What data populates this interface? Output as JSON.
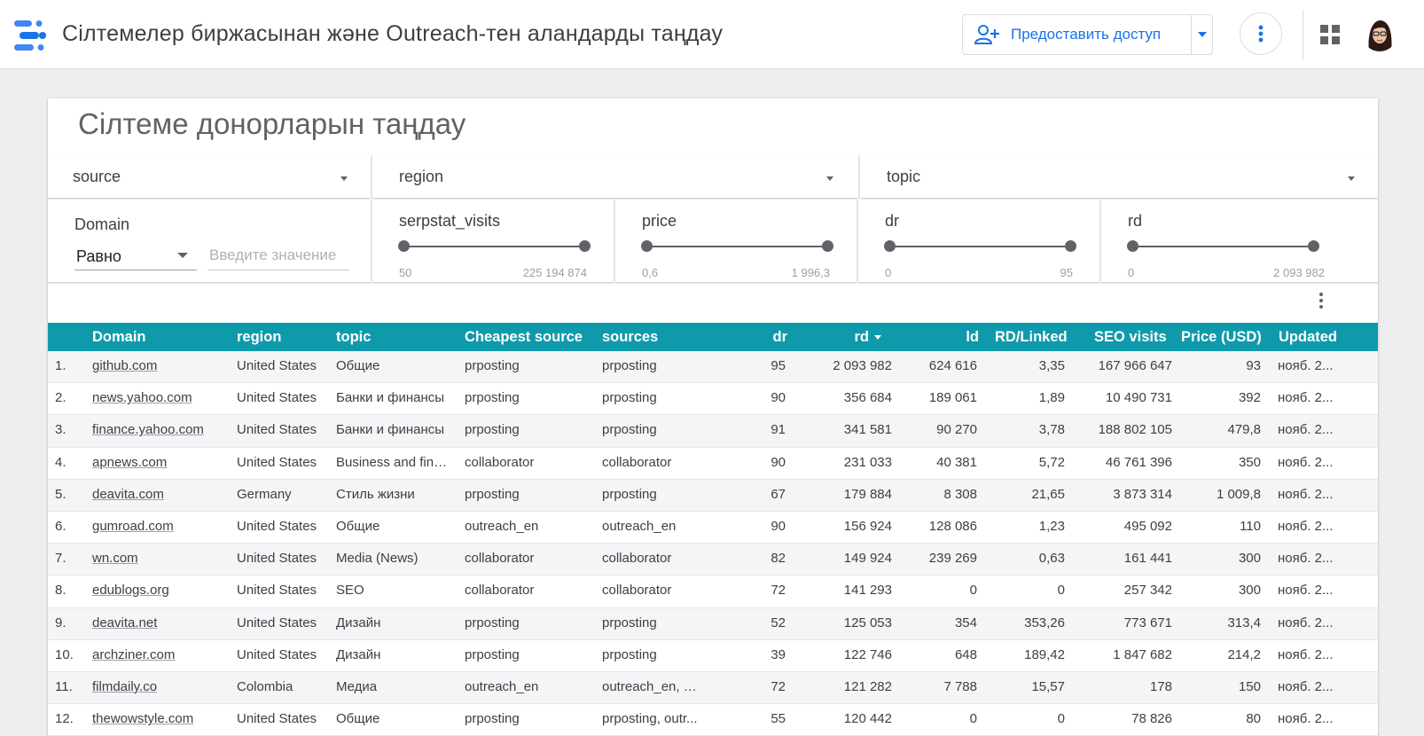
{
  "app": {
    "title": "Сілтемелер биржасынан және Outreach-тен аландарды таңдау",
    "share_label": "Предоставить доступ",
    "brand_colors": {
      "logo_blue": "#4285f4",
      "logo_dark": "#1a73e8",
      "accent": "#1a73e8",
      "table_header": "#0f9aab"
    },
    "icons": {
      "share": "person-add-icon",
      "more": "more-vert-icon",
      "apps": "apps-grid-icon",
      "avatar": "user-avatar"
    }
  },
  "report": {
    "title": "Сілтеме донорларын таңдау",
    "dropdowns": {
      "source": "source",
      "region": "region",
      "topic": "topic"
    },
    "domain_filter": {
      "label": "Domain",
      "operator": "Равно",
      "placeholder": "Введите значение"
    },
    "sliders": {
      "serpstat": {
        "label": "serpstat_visits",
        "min": "50",
        "max": "225 194 874"
      },
      "price": {
        "label": "price",
        "min": "0,6",
        "max": "1 996,3"
      },
      "dr": {
        "label": "dr",
        "min": "0",
        "max": "95"
      },
      "rd": {
        "label": "rd",
        "min": "0",
        "max": "2 093 982"
      }
    }
  },
  "table": {
    "headers": {
      "domain": "Domain",
      "region": "region",
      "topic": "topic",
      "cheapest": "Cheapest source",
      "sources": "sources",
      "dr": "dr",
      "rd": "rd",
      "ld": "ld",
      "rd_linked": "RD/Linked",
      "seo": "SEO visits",
      "price": "Price (USD)",
      "updated": "Updated"
    },
    "sorted_by": "rd",
    "rows": [
      {
        "n": "1.",
        "domain": "github.com",
        "region": "United States",
        "topic": "Общие",
        "cheapest": "prposting",
        "sources": "prposting",
        "dr": "95",
        "rd": "2 093 982",
        "ld": "624 616",
        "rdl": "3,35",
        "seo": "167 966 647",
        "price": "93",
        "updated": "нояб. 2..."
      },
      {
        "n": "2.",
        "domain": "news.yahoo.com",
        "region": "United States",
        "topic": "Банки и финансы",
        "cheapest": "prposting",
        "sources": "prposting",
        "dr": "90",
        "rd": "356 684",
        "ld": "189 061",
        "rdl": "1,89",
        "seo": "10 490 731",
        "price": "392",
        "updated": "нояб. 2..."
      },
      {
        "n": "3.",
        "domain": "finance.yahoo.com",
        "region": "United States",
        "topic": "Банки и финансы",
        "cheapest": "prposting",
        "sources": "prposting",
        "dr": "91",
        "rd": "341 581",
        "ld": "90 270",
        "rdl": "3,78",
        "seo": "188 802 105",
        "price": "479,8",
        "updated": "нояб. 2..."
      },
      {
        "n": "4.",
        "domain": "apnews.com",
        "region": "United States",
        "topic": "Business and fina...",
        "cheapest": "collaborator",
        "sources": "collaborator",
        "dr": "90",
        "rd": "231 033",
        "ld": "40 381",
        "rdl": "5,72",
        "seo": "46 761 396",
        "price": "350",
        "updated": "нояб. 2..."
      },
      {
        "n": "5.",
        "domain": "deavita.com",
        "region": "Germany",
        "topic": "Стиль жизни",
        "cheapest": "prposting",
        "sources": "prposting",
        "dr": "67",
        "rd": "179 884",
        "ld": "8 308",
        "rdl": "21,65",
        "seo": "3 873 314",
        "price": "1 009,8",
        "updated": "нояб. 2..."
      },
      {
        "n": "6.",
        "domain": "gumroad.com",
        "region": "United States",
        "topic": "Общие",
        "cheapest": "outreach_en",
        "sources": "outreach_en",
        "dr": "90",
        "rd": "156 924",
        "ld": "128 086",
        "rdl": "1,23",
        "seo": "495 092",
        "price": "110",
        "updated": "нояб. 2..."
      },
      {
        "n": "7.",
        "domain": "wn.com",
        "region": "United States",
        "topic": "Media (News)",
        "cheapest": "collaborator",
        "sources": "collaborator",
        "dr": "82",
        "rd": "149 924",
        "ld": "239 269",
        "rdl": "0,63",
        "seo": "161 441",
        "price": "300",
        "updated": "нояб. 2..."
      },
      {
        "n": "8.",
        "domain": "edublogs.org",
        "region": "United States",
        "topic": "SEO",
        "cheapest": "collaborator",
        "sources": "collaborator",
        "dr": "72",
        "rd": "141 293",
        "ld": "0",
        "rdl": "0",
        "seo": "257 342",
        "price": "300",
        "updated": "нояб. 2..."
      },
      {
        "n": "9.",
        "domain": "deavita.net",
        "region": "United States",
        "topic": "Дизайн",
        "cheapest": "prposting",
        "sources": "prposting",
        "dr": "52",
        "rd": "125 053",
        "ld": "354",
        "rdl": "353,26",
        "seo": "773 671",
        "price": "313,4",
        "updated": "нояб. 2..."
      },
      {
        "n": "10.",
        "domain": "archziner.com",
        "region": "United States",
        "topic": "Дизайн",
        "cheapest": "prposting",
        "sources": "prposting",
        "dr": "39",
        "rd": "122 746",
        "ld": "648",
        "rdl": "189,42",
        "seo": "1 847 682",
        "price": "214,2",
        "updated": "нояб. 2..."
      },
      {
        "n": "11.",
        "domain": "filmdaily.co",
        "region": "Colombia",
        "topic": "Медиа",
        "cheapest": "outreach_en",
        "sources": "outreach_en, p...",
        "dr": "72",
        "rd": "121 282",
        "ld": "7 788",
        "rdl": "15,57",
        "seo": "178",
        "price": "150",
        "updated": "нояб. 2..."
      },
      {
        "n": "12.",
        "domain": "thewowstyle.com",
        "region": "United States",
        "topic": "Общие",
        "cheapest": "prposting",
        "sources": "prposting, outr...",
        "dr": "55",
        "rd": "120 442",
        "ld": "0",
        "rdl": "0",
        "seo": "78 826",
        "price": "80",
        "updated": "нояб. 2..."
      }
    ]
  }
}
